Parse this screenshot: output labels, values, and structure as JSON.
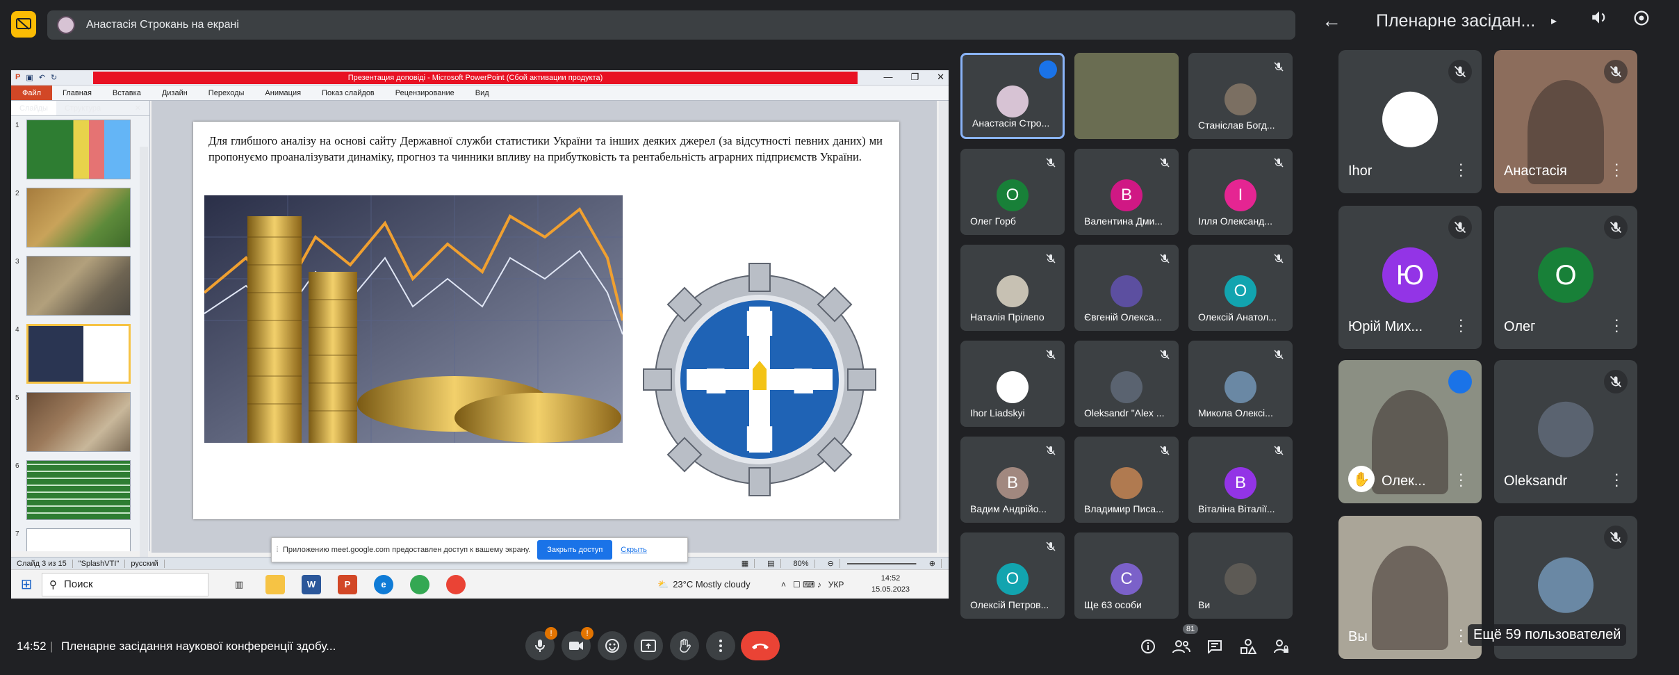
{
  "share_bar": {
    "text": "Анастасія Строкань на екрані"
  },
  "powerpoint": {
    "title": "Презентация доповіді - Microsoft PowerPoint (Сбой активации продукта)",
    "ribbon_file": "Файл",
    "ribbon_tabs": [
      "Главная",
      "Вставка",
      "Дизайн",
      "Переходы",
      "Анимация",
      "Показ слайдов",
      "Рецензирование",
      "Вид"
    ],
    "left_tabs": [
      "Слайды",
      "Структура"
    ],
    "slide_numbers": [
      "1",
      "2",
      "3",
      "4",
      "5",
      "6",
      "7"
    ],
    "slide_text": "Для глибшого аналізу на основі сайту Державної служби статистики України та інших деяких джерел (за відсутності певних даних) ми пропонуємо проаналізувати динаміку, прогноз та чинники впливу на прибутковість та рентабельність аграрних підприємств України.",
    "status": {
      "slide": "Слайд 3 из 15",
      "theme": "\"SplashVTI\"",
      "lang": "русский",
      "zoom": "80%"
    },
    "notify": {
      "text": "Приложению meet.google.com предоставлен доступ к вашему экрану.",
      "stop": "Закрыть доступ",
      "hide": "Скрыть"
    },
    "taskbar": {
      "search": "Поиск",
      "weather": "23°C  Mostly cloudy",
      "lang": "УКР",
      "time": "14:52",
      "date": "15.05.2023"
    }
  },
  "middle_grid": [
    {
      "name": "Анастасія Стро...",
      "initial": "",
      "color": "#d7c3d4"
    },
    {
      "name": "",
      "initial": "",
      "color": "#6a6d52"
    },
    {
      "name": "Станіслав Богд...",
      "initial": "",
      "color": "#7b6f62"
    },
    {
      "name": "Олег Горб",
      "initial": "О",
      "color": "#188038"
    },
    {
      "name": "Валентина Дми...",
      "initial": "В",
      "color": "#d01884"
    },
    {
      "name": "Ілля Олександ...",
      "initial": "І",
      "color": "#e52592"
    },
    {
      "name": "Наталія Прілепо",
      "initial": "",
      "color": "#c7c1b3"
    },
    {
      "name": "Євгеній Олекса...",
      "initial": "",
      "color": "#5c4fa0"
    },
    {
      "name": "Олексій Анатол...",
      "initial": "О",
      "color": "#12a4af"
    },
    {
      "name": "Ihor Liadskyi",
      "initial": "",
      "color": "#ffffff"
    },
    {
      "name": "Oleksandr \"Alex ...",
      "initial": "",
      "color": "#5a6370"
    },
    {
      "name": "Микола Олексі...",
      "initial": "",
      "color": "#6a88a4"
    },
    {
      "name": "Вадим Андрійо...",
      "initial": "В",
      "color": "#a1887f"
    },
    {
      "name": "Владимир Писа...",
      "initial": "",
      "color": "#b07a50"
    },
    {
      "name": "Віталіна Віталії...",
      "initial": "В",
      "color": "#9334e6"
    },
    {
      "name": "Олексій Петров...",
      "initial": "О",
      "color": "#12a4af"
    },
    {
      "name": "Ще 63 особи",
      "initial": "С",
      "color": "#7b61c9"
    },
    {
      "name": "Ви",
      "initial": "",
      "color": "#5d5a55"
    }
  ],
  "right_panel": {
    "title": "Пленарне засідан...",
    "tiles": [
      {
        "name": "Ihor",
        "initial": "",
        "color": "#ffffff"
      },
      {
        "name": "Анастасія",
        "initial": "",
        "color": "#8c6d5c"
      },
      {
        "name": "Юрій Мих...",
        "initial": "Ю",
        "color": "#9334e6"
      },
      {
        "name": "Олег",
        "initial": "О",
        "color": "#188038"
      },
      {
        "name": "Олек...",
        "initial": "",
        "color": "#8b8f83"
      },
      {
        "name": "Oleksandr",
        "initial": "",
        "color": "#5a6370"
      },
      {
        "name": "Вы",
        "initial": "",
        "color": "#aaa598"
      },
      {
        "name": "",
        "initial": "",
        "color": "#6a88a4"
      }
    ],
    "more_users": "Ещё 59 пользователей"
  },
  "bottom_bar": {
    "time": "14:52",
    "separator": "|",
    "meeting_title": "Пленарне засідання наукової конференції здобу...",
    "participants_count": "81"
  },
  "colors": {
    "accent": "#8ab4f8",
    "end_call": "#ea4335",
    "warning": "#e37400",
    "share": "#fbbc04"
  }
}
